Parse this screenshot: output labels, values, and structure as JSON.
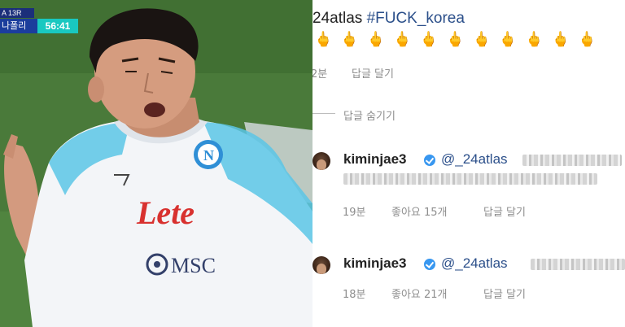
{
  "broadcast": {
    "score_bug": {
      "top": "A 13R",
      "team": "나폴리",
      "clock": "56:41"
    },
    "jersey": {
      "sponsor": "Lete",
      "sub_sponsor": "MSC"
    }
  },
  "instagram": {
    "colors": {
      "hashtag": "#2b4f8a",
      "meta_gray": "#8e8e8e",
      "verified": "#3897f0"
    },
    "top_comment": {
      "username": "24atlas",
      "hashtag": "#FUCK_korea",
      "emojis": "🖕🖕🖕🖕🖕🖕🖕🖕🖕🖕🖕",
      "time": "2분",
      "reply_label": "답글 달기"
    },
    "hide_replies_label": "답글 숨기기",
    "replies": [
      {
        "username": "kiminjae3",
        "verified": true,
        "mention": "@_24atlas",
        "time": "19분",
        "likes": "좋아요 15개",
        "reply_label": "답글 달기"
      },
      {
        "username": "kiminjae3",
        "verified": true,
        "mention": "@_24atlas",
        "time": "18분",
        "likes": "좋아요 21개",
        "reply_label": "답글 달기"
      }
    ]
  }
}
